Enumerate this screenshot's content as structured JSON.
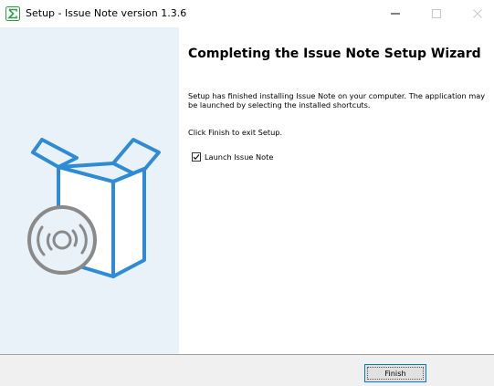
{
  "window": {
    "title": "Setup - Issue Note version 1.3.6"
  },
  "icons": {
    "app": "sigma-app-icon",
    "minimize": "minimize-icon",
    "maximize": "maximize-icon",
    "close": "close-icon",
    "illustration": "software-box-disc-icon",
    "check": "checkmark-icon"
  },
  "content": {
    "heading": "Completing the Issue Note Setup Wizard",
    "message": "Setup has finished installing Issue Note on your computer. The application may be launched by selecting the installed shortcuts.",
    "exit_hint": "Click Finish to exit Setup.",
    "launch_checkbox": {
      "label": "Launch Issue Note",
      "checked": true
    }
  },
  "buttons": {
    "finish_label": "Finish"
  },
  "colors": {
    "accent": "#0078d7",
    "left_panel": "#e9f2f9",
    "illustration": "#2f8bd6",
    "bottom_bar": "#f0f0f0"
  }
}
